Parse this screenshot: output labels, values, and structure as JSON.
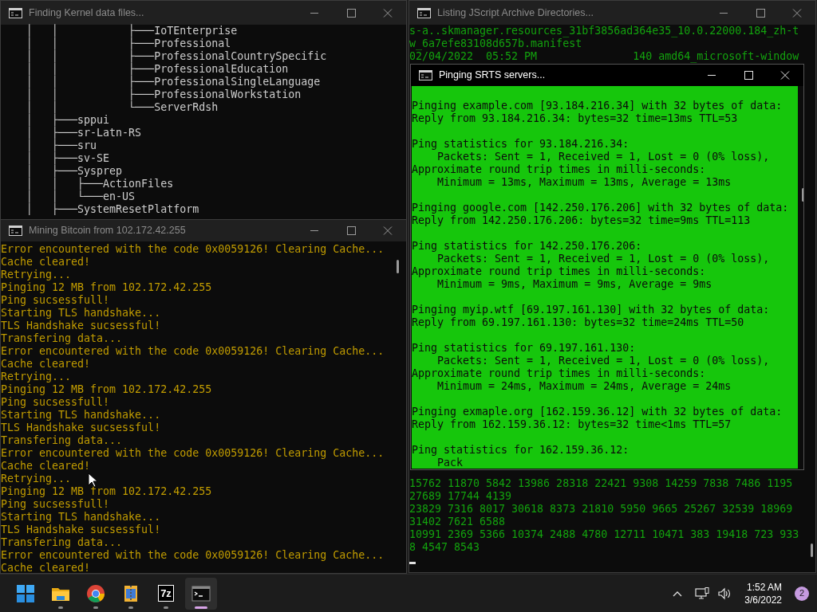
{
  "windows": [
    {
      "kind": "tree",
      "title": "Finding Kernel data files...",
      "active": false,
      "lines": [
        "    │   │           ├───IoTEnterprise",
        "    │   │           ├───Professional",
        "    │   │           ├───ProfessionalCountrySpecific",
        "    │   │           ├───ProfessionalEducation",
        "    │   │           ├───ProfessionalSingleLanguage",
        "    │   │           ├───ProfessionalWorkstation",
        "    │   │           └───ServerRdsh",
        "    │   ├───sppui",
        "    │   ├───sr-Latn-RS",
        "    │   ├───sru",
        "    │   ├───sv-SE",
        "    │   ├───Sysprep",
        "    │   │   ├───ActionFiles",
        "    │   │   └───en-US",
        "    │   ├───SystemResetPlatform"
      ]
    },
    {
      "kind": "listing",
      "title": "Listing JScript Archive Directories...",
      "active": false,
      "cursor": true,
      "top_lines": [
        "s-a..skmanager.resources_31bf3856ad364e35_10.0.22000.184_zh-t",
        "w_6a7efe83108d657b.manifest",
        "02/04/2022  05:52 PM               140 amd64_microsoft-window"
      ],
      "bottom_lines": [
        "15762 11870 5842 13986 28318 22421 9308 14259 7838 7486 1195",
        "27689 17744 4139",
        "23829 7316 8017 30618 8373 21810 5950 9665 25267 32539 18969",
        "31402 7621 6588",
        "10991 2369 5366 10374 2488 4780 12711 10471 383 19418 723 933",
        "8 4547 8543"
      ]
    },
    {
      "kind": "log",
      "title": "Mining Bitcoin from 102.172.42.255",
      "active": false,
      "lines": [
        "Error encountered with the code 0x0059126! Clearing Cache...",
        "Cache cleared!",
        "Retrying...",
        "Pinging 12 MB from 102.172.42.255",
        "Ping sucsessfull!",
        "Starting TLS handshake...",
        "TLS Handshake sucsessful!",
        "Transfering data...",
        "Error encountered with the code 0x0059126! Clearing Cache...",
        "Cache cleared!",
        "Retrying...",
        "Pinging 12 MB from 102.172.42.255",
        "Ping sucsessfull!",
        "Starting TLS handshake...",
        "TLS Handshake sucsessful!",
        "Transfering data...",
        "Error encountered with the code 0x0059126! Clearing Cache...",
        "Cache cleared!",
        "Retrying...",
        "Pinging 12 MB from 102.172.42.255",
        "Ping sucsessfull!",
        "Starting TLS handshake...",
        "TLS Handshake sucsessful!",
        "Transfering data...",
        "Error encountered with the code 0x0059126! Clearing Cache...",
        "Cache cleared!"
      ]
    },
    {
      "kind": "ping",
      "title": "Pinging SRTS servers...",
      "active": true,
      "blocks": [
        [
          "Pinging example.com [93.184.216.34] with 32 bytes of data:",
          "Reply from 93.184.216.34: bytes=32 time=13ms TTL=53"
        ],
        [
          "Ping statistics for 93.184.216.34:",
          "    Packets: Sent = 1, Received = 1, Lost = 0 (0% loss),",
          "Approximate round trip times in milli-seconds:",
          "    Minimum = 13ms, Maximum = 13ms, Average = 13ms"
        ],
        [
          "Pinging google.com [142.250.176.206] with 32 bytes of data:",
          "Reply from 142.250.176.206: bytes=32 time=9ms TTL=113"
        ],
        [
          "Ping statistics for 142.250.176.206:",
          "    Packets: Sent = 1, Received = 1, Lost = 0 (0% loss),",
          "Approximate round trip times in milli-seconds:",
          "    Minimum = 9ms, Maximum = 9ms, Average = 9ms"
        ],
        [
          "Pinging myip.wtf [69.197.161.130] with 32 bytes of data:",
          "Reply from 69.197.161.130: bytes=32 time=24ms TTL=50"
        ],
        [
          "Ping statistics for 69.197.161.130:",
          "    Packets: Sent = 1, Received = 1, Lost = 0 (0% loss),",
          "Approximate round trip times in milli-seconds:",
          "    Minimum = 24ms, Maximum = 24ms, Average = 24ms"
        ],
        [
          "Pinging exmaple.org [162.159.36.12] with 32 bytes of data:",
          "Reply from 162.159.36.12: bytes=32 time<1ms TTL=57"
        ],
        [
          "Ping statistics for 162.159.36.12:",
          "    Pack"
        ]
      ]
    }
  ],
  "taskbar": {
    "apps": [
      {
        "kind": "start",
        "running": false,
        "selected": false
      },
      {
        "kind": "folder",
        "running": true,
        "selected": false
      },
      {
        "kind": "browser",
        "running": true,
        "selected": false
      },
      {
        "kind": "archive",
        "running": true,
        "selected": false
      },
      {
        "kind": "label",
        "label": "7z",
        "running": true,
        "selected": false
      },
      {
        "kind": "terminal",
        "running": true,
        "selected": true
      }
    ],
    "time": "1:52 AM",
    "date": "3/6/2022",
    "notifications": "2"
  }
}
